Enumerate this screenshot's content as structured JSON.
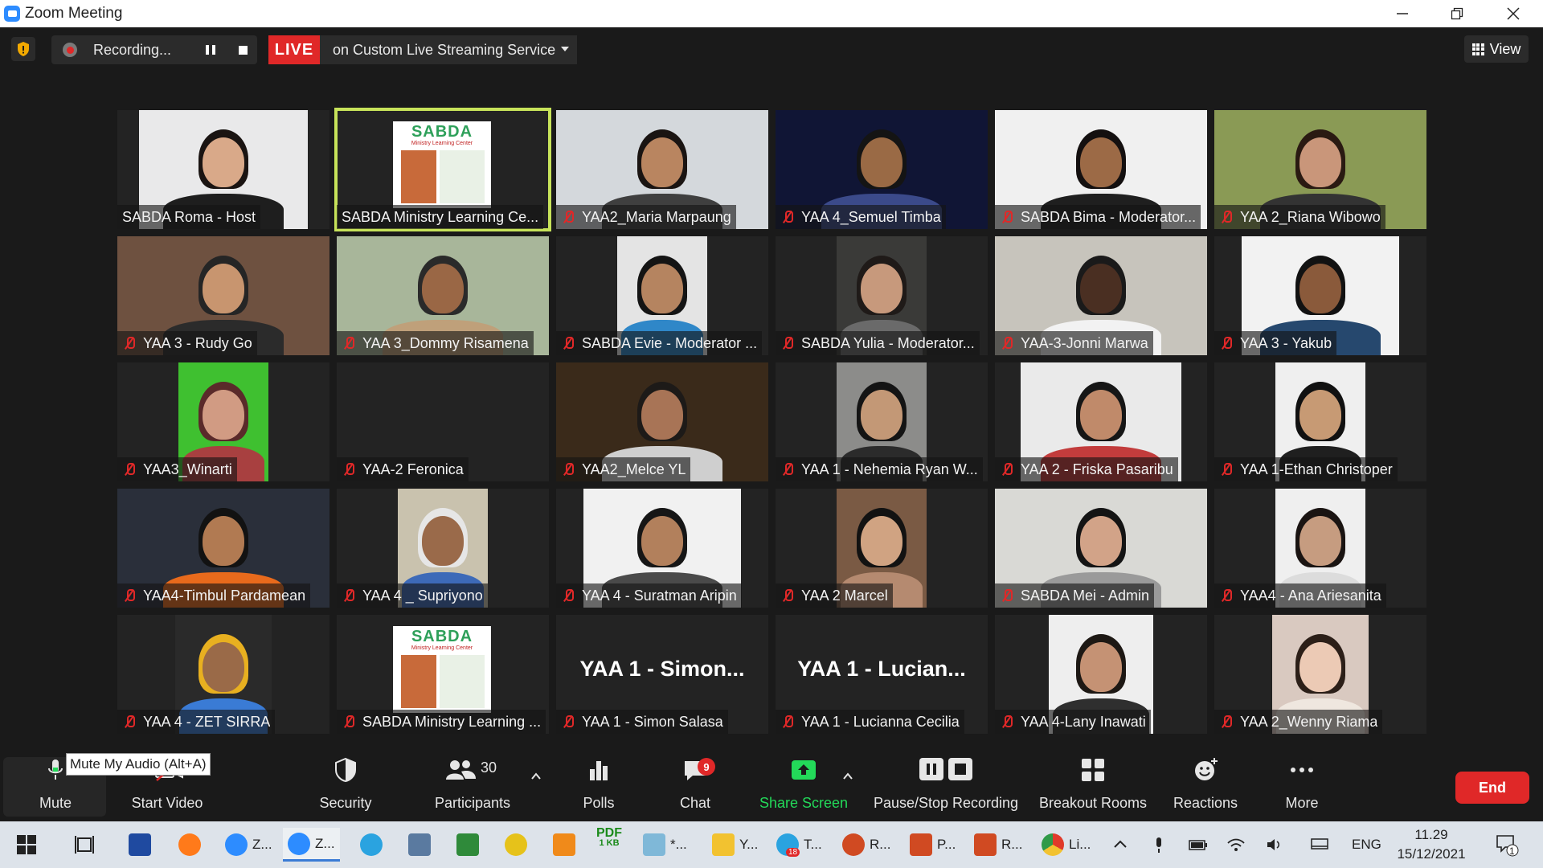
{
  "window": {
    "title": "Zoom Meeting"
  },
  "topbar": {
    "recording_label": "Recording...",
    "live_label": "LIVE",
    "live_service": "on Custom Live Streaming Service",
    "view_label": "View"
  },
  "participants": [
    {
      "name": "SABDA Roma - Host",
      "muted": false,
      "video": "person",
      "bg": "#e9e9ea",
      "skin": "#d9a989",
      "hair": "#1a1412",
      "shirt": "#1e1e1e",
      "pw": 210
    },
    {
      "name": "SABDA Ministry Learning Ce...",
      "muted": false,
      "video": "sabda",
      "active": true
    },
    {
      "name": "YAA2_Maria Marpaung",
      "muted": true,
      "video": "person",
      "bg": "#d4d8dc",
      "skin": "#b98560",
      "hair": "#1a1412",
      "shirt": "#3f3f3f",
      "pw": 264
    },
    {
      "name": "YAA 4_Semuel Timba",
      "muted": true,
      "video": "person",
      "bg": "#101535",
      "skin": "#9a6a45",
      "hair": "#141414",
      "shirt": "#3b4a8a",
      "pw": 264
    },
    {
      "name": "SABDA Bima - Moderator...",
      "muted": true,
      "video": "person",
      "bg": "#f0f0f0",
      "skin": "#9c6a46",
      "hair": "#141010",
      "shirt": "#1f1f1f",
      "pw": 264
    },
    {
      "name": "YAA 2_Riana Wibowo",
      "muted": true,
      "video": "person",
      "bg": "#8a9a55",
      "skin": "#c9967a",
      "hair": "#2a1a12",
      "shirt": "#333333",
      "pw": 264
    },
    {
      "name": "YAA 3 - Rudy Go",
      "muted": true,
      "video": "person",
      "bg": "#6e5140",
      "skin": "#c8956f",
      "hair": "#252525",
      "shirt": "#2b2b2b",
      "pw": 264
    },
    {
      "name": "YAA 3_Dommy Risamena",
      "muted": true,
      "video": "person",
      "bg": "#a8b69a",
      "skin": "#9a6745",
      "hair": "#2a2a2a",
      "shirt": "#bfa07a",
      "pw": 264
    },
    {
      "name": "SABDA Evie - Moderator ...",
      "muted": true,
      "video": "person",
      "bg": "#e4e4e4",
      "skin": "#b58460",
      "hair": "#141414",
      "shirt": "#2f87c8",
      "pw": 112
    },
    {
      "name": "SABDA Yulia - Moderator...",
      "muted": true,
      "video": "person",
      "bg": "#3a3a38",
      "skin": "#c7997c",
      "hair": "#1f1a18",
      "shirt": "#6a6a6a",
      "pw": 112
    },
    {
      "name": "YAA-3-Jonni Marwa",
      "muted": true,
      "video": "person",
      "bg": "#c7c4bc",
      "skin": "#4a2f22",
      "hair": "#1a1a1a",
      "shirt": "#f2f2f2",
      "pw": 264
    },
    {
      "name": "YAA 3 - Yakub",
      "muted": true,
      "video": "person",
      "bg": "#f2f2f2",
      "skin": "#8a5a3b",
      "hair": "#121212",
      "shirt": "#26486e",
      "pw": 196
    },
    {
      "name": "YAA3_Winarti",
      "muted": true,
      "video": "person",
      "bg": "#3fc030",
      "skin": "#d19b83",
      "hair": "#5a2a2a",
      "shirt": "#a84040",
      "pw": 112
    },
    {
      "name": "YAA-2 Feronica",
      "muted": true,
      "video": "none"
    },
    {
      "name": "YAA2_Melce YL",
      "muted": true,
      "video": "person",
      "bg": "#3a2a1a",
      "skin": "#a87456",
      "hair": "#1d1a18",
      "shirt": "#cfcfcf",
      "pw": 264
    },
    {
      "name": "YAA 1 - Nehemia Ryan W...",
      "muted": true,
      "video": "person",
      "bg": "#8c8c8a",
      "skin": "#c39876",
      "hair": "#141414",
      "shirt": "#2b2b2b",
      "pw": 112
    },
    {
      "name": "YAA 2 - Friska Pasaribu",
      "muted": true,
      "video": "person",
      "bg": "#eaeaea",
      "skin": "#c08a6a",
      "hair": "#161616",
      "shirt": "#c23c3c",
      "pw": 200
    },
    {
      "name": "YAA 1-Ethan Christoper",
      "muted": true,
      "video": "person",
      "bg": "#efefef",
      "skin": "#c79a74",
      "hair": "#111111",
      "shirt": "#1f1f1f",
      "pw": 112
    },
    {
      "name": "YAA4-Timbul Pardamean",
      "muted": true,
      "video": "person",
      "bg": "#2a2f3a",
      "skin": "#b17a52",
      "hair": "#121212",
      "shirt": "#e86a1c",
      "pw": 264
    },
    {
      "name": "YAA 4 _ Supriyono",
      "muted": true,
      "video": "person",
      "bg": "#c9c2ae",
      "skin": "#9a6a4a",
      "hair": "#e6e6e6",
      "shirt": "#3d6ab8",
      "pw": 112
    },
    {
      "name": "YAA 4 - Suratman Aripin",
      "muted": true,
      "video": "person",
      "bg": "#f1f1f1",
      "skin": "#b2805c",
      "hair": "#161616",
      "shirt": "#4a4a4a",
      "pw": 196
    },
    {
      "name": "YAA 2 Marcel",
      "muted": true,
      "video": "person",
      "bg": "#7a5a44",
      "skin": "#d0a382",
      "hair": "#121212",
      "shirt": "#b58a70",
      "pw": 112
    },
    {
      "name": "SABDA Mei - Admin",
      "muted": true,
      "video": "person",
      "bg": "#d9d9d5",
      "skin": "#d2a388",
      "hair": "#141414",
      "shirt": "#9a9a9a",
      "pw": 264
    },
    {
      "name": "YAA4 - Ana Ariesanita",
      "muted": true,
      "video": "person",
      "bg": "#efefef",
      "skin": "#c69c80",
      "hair": "#1a1412",
      "shirt": "#dcdcdc",
      "pw": 112
    },
    {
      "name": "YAA 4 - ZET SIRRA",
      "muted": true,
      "video": "person",
      "bg": "#2a2a2a",
      "skin": "#9a6a48",
      "hair": "#e8b020",
      "shirt": "#3a7bd5",
      "pw": 120
    },
    {
      "name": "SABDA Ministry Learning ...",
      "muted": true,
      "video": "sabda"
    },
    {
      "name": "YAA 1 - Simon Salasa",
      "muted": true,
      "video": "text",
      "big": "YAA 1 - Simon..."
    },
    {
      "name": "YAA 1 -  Lucianna Cecilia",
      "muted": true,
      "video": "text",
      "big": "YAA 1 -  Lucian..."
    },
    {
      "name": "YAA 4-Lany Inawati",
      "muted": true,
      "video": "person",
      "bg": "#eeeeee",
      "skin": "#c59274",
      "hair": "#1d1814",
      "shirt": "#2f2f2f",
      "pw": 130
    },
    {
      "name": "YAA 2_Wenny Riama",
      "muted": true,
      "video": "person",
      "bg": "#d9c9c0",
      "skin": "#eccab5",
      "hair": "#2c1f18",
      "shirt": "#efe7df",
      "pw": 120
    }
  ],
  "sabda_logo": {
    "brand": "SABDA",
    "subtitle": "Ministry Learning Center"
  },
  "tooltip": "Mute My Audio (Alt+A)",
  "toolbar": {
    "mute": "Mute",
    "start_video": "Start Video",
    "security": "Security",
    "participants": "Participants",
    "participants_count": "30",
    "polls": "Polls",
    "chat": "Chat",
    "chat_badge": "9",
    "share_screen": "Share Screen",
    "pause_stop_recording": "Pause/Stop Recording",
    "breakout_rooms": "Breakout Rooms",
    "reactions": "Reactions",
    "more": "More",
    "end": "End"
  },
  "taskbar": {
    "apps": [
      "Z...",
      "Z...",
      "*...",
      "Y...",
      "T...",
      "R...",
      "P...",
      "R...",
      "Li..."
    ],
    "pdf_label": "PDF",
    "pdf_size": "1 KB",
    "telegram_badge": "18",
    "language": "ENG",
    "time": "11.29",
    "date": "15/12/2021",
    "notification_count": "1"
  },
  "colors": {
    "accent_blue": "#2d8cff",
    "live_red": "#e02828",
    "share_green": "#23d959",
    "active_speaker": "#c7e35a"
  }
}
